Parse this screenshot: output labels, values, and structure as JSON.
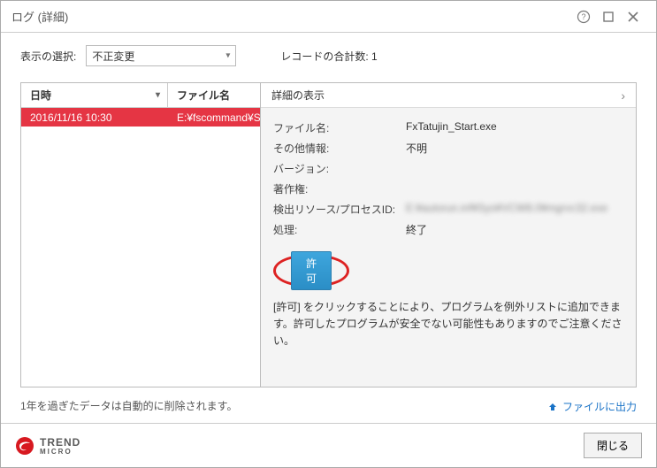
{
  "titlebar": {
    "title": "ログ (詳細)"
  },
  "top": {
    "display_select_label": "表示の選択:",
    "select_value": "不正変更",
    "records_label": "レコードの合計数:",
    "records_count": "1"
  },
  "table": {
    "headers": {
      "date": "日時",
      "file": "ファイル名"
    },
    "rows": [
      {
        "date": "2016/11/16 10:30",
        "file": "E:¥fscommand¥S"
      }
    ]
  },
  "detail": {
    "head": "詳細の表示",
    "fields": {
      "file_label": "ファイル名:",
      "file_value": "FxTatujin_Start.exe",
      "other_label": "その他情報:",
      "other_value": "不明",
      "version_label": "バージョン:",
      "version_value": "",
      "author_label": "著作権:",
      "author_value": "",
      "res_label": "検出リソース/プロセスID:",
      "res_value": "E:¥autorun.inf¥Sys¥VCW8.0¥mgrvc32.exe",
      "action_label": "処理:",
      "action_value": "終了"
    },
    "allow_button": "許可",
    "note": "[許可] をクリックすることにより、プログラムを例外リストに追加できます。許可したプログラムが安全でない可能性もありますのでご注意ください。"
  },
  "bottom_note": "1年を過ぎたデータは自動的に削除されます。",
  "export_link": "ファイルに出力",
  "footer": {
    "brand_top": "TREND",
    "brand_bottom": "MICRO",
    "close": "閉じる"
  }
}
